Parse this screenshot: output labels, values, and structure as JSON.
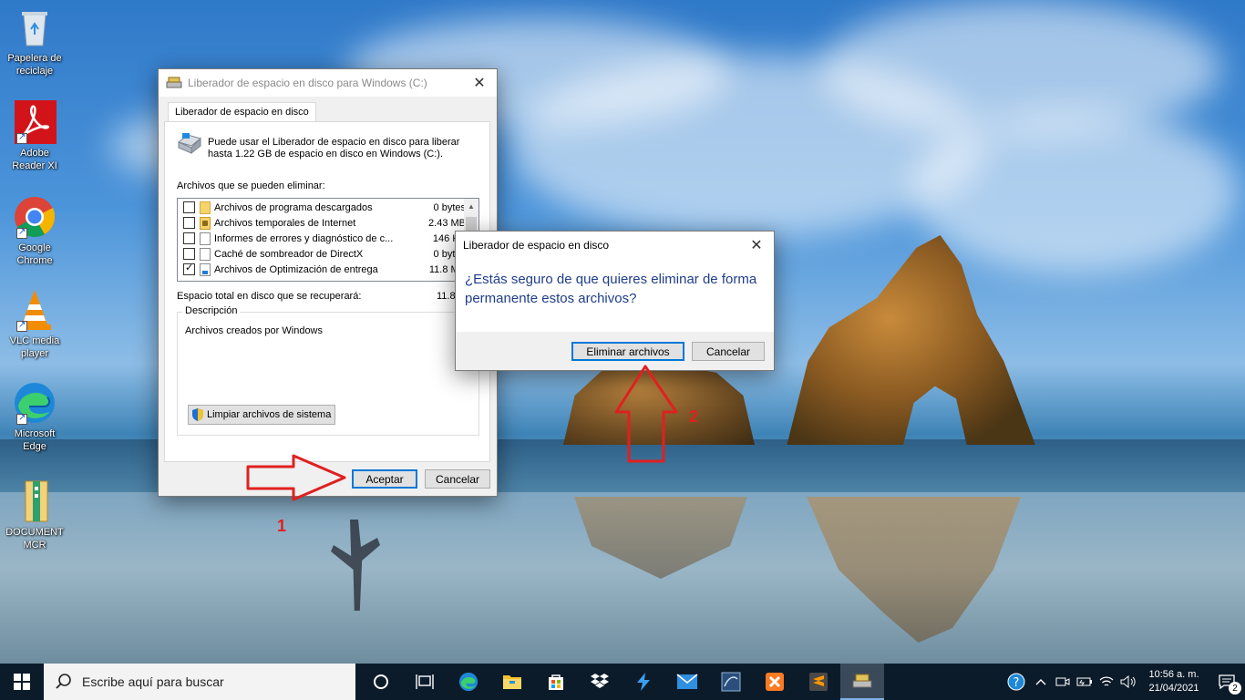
{
  "desktop": {
    "icons": [
      {
        "label": "Papelera de reciclaje"
      },
      {
        "label": "Adobe Reader XI"
      },
      {
        "label": "Google Chrome"
      },
      {
        "label": "VLC media player"
      },
      {
        "label": "Microsoft Edge"
      },
      {
        "label": "DOCUMENT MCR"
      }
    ]
  },
  "cleanup_window": {
    "title": "Liberador de espacio en disco para Windows (C:)",
    "tab": "Liberador de espacio en disco",
    "intro": "Puede usar el Liberador de espacio en disco para liberar hasta 1.22 GB de espacio en disco en Windows (C:).",
    "files_label": "Archivos que se pueden eliminar:",
    "files": [
      {
        "name": "Archivos de programa descargados",
        "size": "0 bytes",
        "checked": false
      },
      {
        "name": "Archivos temporales de Internet",
        "size": "2.43 MB",
        "checked": false
      },
      {
        "name": "Informes de errores y diagnóstico de c...",
        "size": "146 KB",
        "checked": false
      },
      {
        "name": "Caché de sombreador de DirectX",
        "size": "0 bytes",
        "checked": false
      },
      {
        "name": "Archivos de Optimización de entrega",
        "size": "11.8 MB",
        "checked": true
      }
    ],
    "total_label": "Espacio total en disco que se recuperará:",
    "total_value": "11.8",
    "description_legend": "Descripción",
    "description_text": "Archivos creados por Windows",
    "system_button": "Limpiar archivos de sistema",
    "ok_button": "Aceptar",
    "cancel_button": "Cancelar"
  },
  "confirm_dialog": {
    "title": "Liberador de espacio en disco",
    "question": "¿Estás seguro de que quieres eliminar de forma permanente estos archivos?",
    "delete_button": "Eliminar archivos",
    "cancel_button": "Cancelar"
  },
  "annotations": {
    "step1": "1",
    "step2": "2",
    "color": "#e02020"
  },
  "taskbar": {
    "search_placeholder": "Escribe aquí para buscar",
    "time": "10:56 a. m.",
    "date": "21/04/2021",
    "notification_count": "2"
  }
}
